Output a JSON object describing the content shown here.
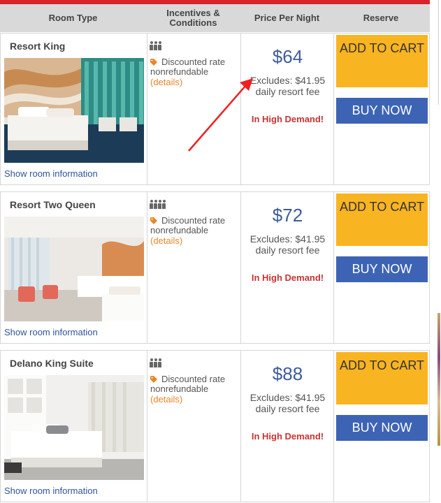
{
  "header": {
    "col_room_type": "Room Type",
    "col_incentives": "Incentives & Conditions",
    "col_price": "Price Per Night",
    "col_reserve": "Reserve"
  },
  "rooms": [
    {
      "name": "Resort King",
      "show_info": "Show room information",
      "guests": 3,
      "incentive": "Discounted rate nonrefundable",
      "details": "(details)",
      "price": "$64",
      "excludes": "Excludes: $41.95 daily resort fee",
      "demand": "In High Demand!",
      "add_to_cart": "ADD TO CART",
      "buy_now": "BUY NOW"
    },
    {
      "name": "Resort Two Queen",
      "show_info": "Show room information",
      "guests": 4,
      "incentive": "Discounted rate nonrefundable",
      "details": "(details)",
      "price": "$72",
      "excludes": "Excludes: $41.95 daily resort fee",
      "demand": "In High Demand!",
      "add_to_cart": "ADD TO CART",
      "buy_now": "BUY NOW"
    },
    {
      "name": "Delano King Suite",
      "show_info": "Show room information",
      "guests": 3,
      "incentive": "Discounted rate nonrefundable",
      "details": "(details)",
      "price": "$88",
      "excludes": "Excludes: $41.95 daily resort fee",
      "demand": "In High Demand!",
      "add_to_cart": "ADD TO CART",
      "buy_now": "BUY NOW"
    }
  ],
  "colors": {
    "brand_red": "#d8232a",
    "price_blue": "#3e5c9a",
    "add_to_cart_yellow": "#f9b421",
    "buy_now_blue": "#3d64b4",
    "details_orange": "#e8862a",
    "demand_red": "#c83232",
    "annotation_arrow": "#f02020"
  }
}
